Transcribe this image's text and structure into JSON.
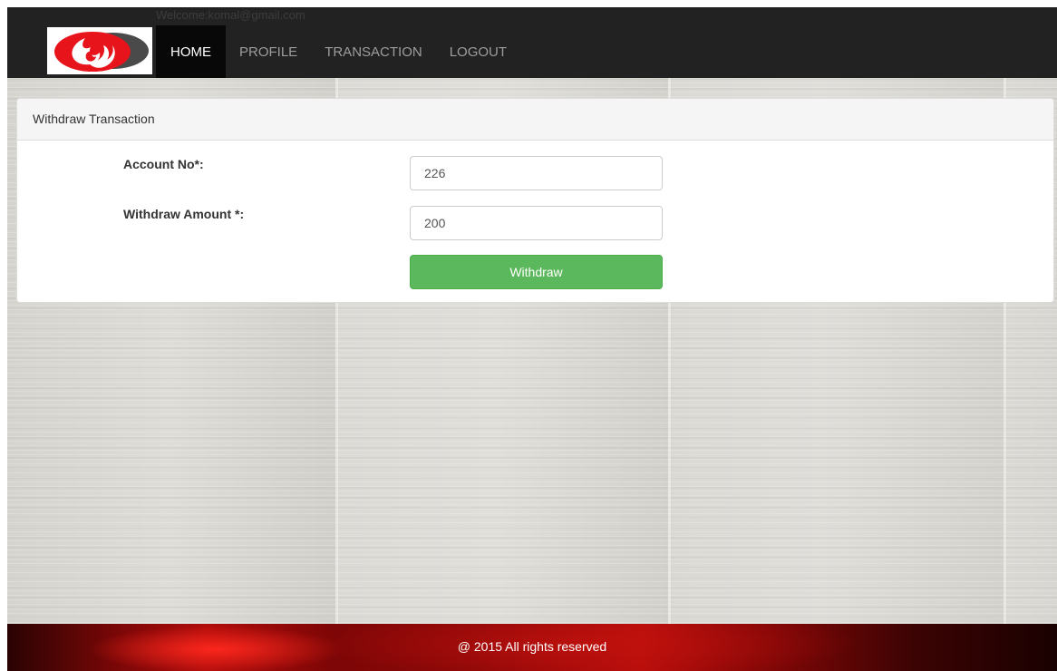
{
  "header": {
    "welcome_text": "Welcome:komal@gmail.com",
    "nav": [
      {
        "label": "HOME",
        "active": true
      },
      {
        "label": "PROFILE",
        "active": false
      },
      {
        "label": "TRANSACTION",
        "active": false
      },
      {
        "label": "LOGOUT",
        "active": false
      }
    ],
    "logo_icon": "flame-logo-icon"
  },
  "panel": {
    "title": "Withdraw Transaction",
    "account_label": "Account No*:",
    "account_value": "226",
    "amount_label": "Withdraw Amount *:",
    "amount_value": "200",
    "submit_label": "Withdraw"
  },
  "footer": {
    "text": "@ 2015 All rights reserved"
  },
  "colors": {
    "navbar": "#222222",
    "nav_active": "#080808",
    "button_green": "#5cb85c",
    "footer_red": "#b10d0b"
  }
}
